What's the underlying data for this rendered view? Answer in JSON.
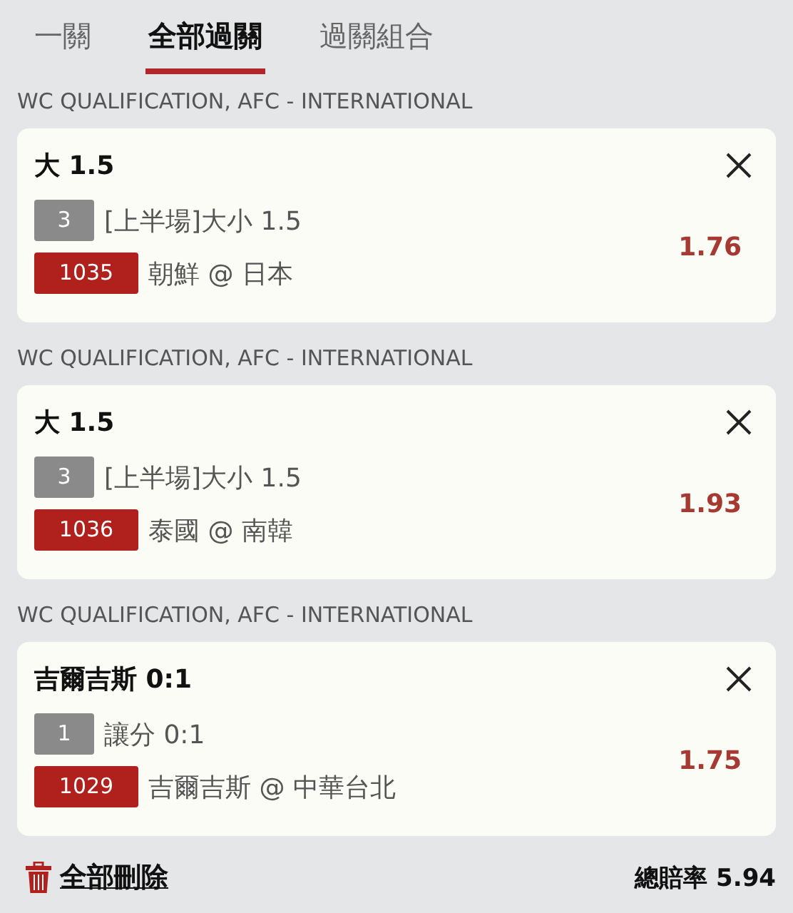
{
  "tabs": [
    {
      "label": "一關",
      "selected": false
    },
    {
      "label": "全部過關",
      "selected": true
    },
    {
      "label": "過關組合",
      "selected": false
    }
  ],
  "bets": [
    {
      "league": "WC QUALIFICATION, AFC - INTERNATIONAL",
      "selection": "大 1.5",
      "period": "3",
      "market": "[上半場]大小 1.5",
      "code": "1035",
      "match": "朝鮮 @ 日本",
      "odds": "1.76"
    },
    {
      "league": "WC QUALIFICATION, AFC - INTERNATIONAL",
      "selection": "大 1.5",
      "period": "3",
      "market": "[上半場]大小 1.5",
      "code": "1036",
      "match": "泰國 @ 南韓",
      "odds": "1.93"
    },
    {
      "league": "WC QUALIFICATION, AFC - INTERNATIONAL",
      "selection": "吉爾吉斯 0:1",
      "period": "1",
      "market": "讓分 0:1",
      "code": "1029",
      "match": "吉爾吉斯 @ 中華台北",
      "odds": "1.75"
    }
  ],
  "footer": {
    "delete_all": "全部刪除",
    "total_label": "總賠率",
    "total_odds": "5.94"
  }
}
